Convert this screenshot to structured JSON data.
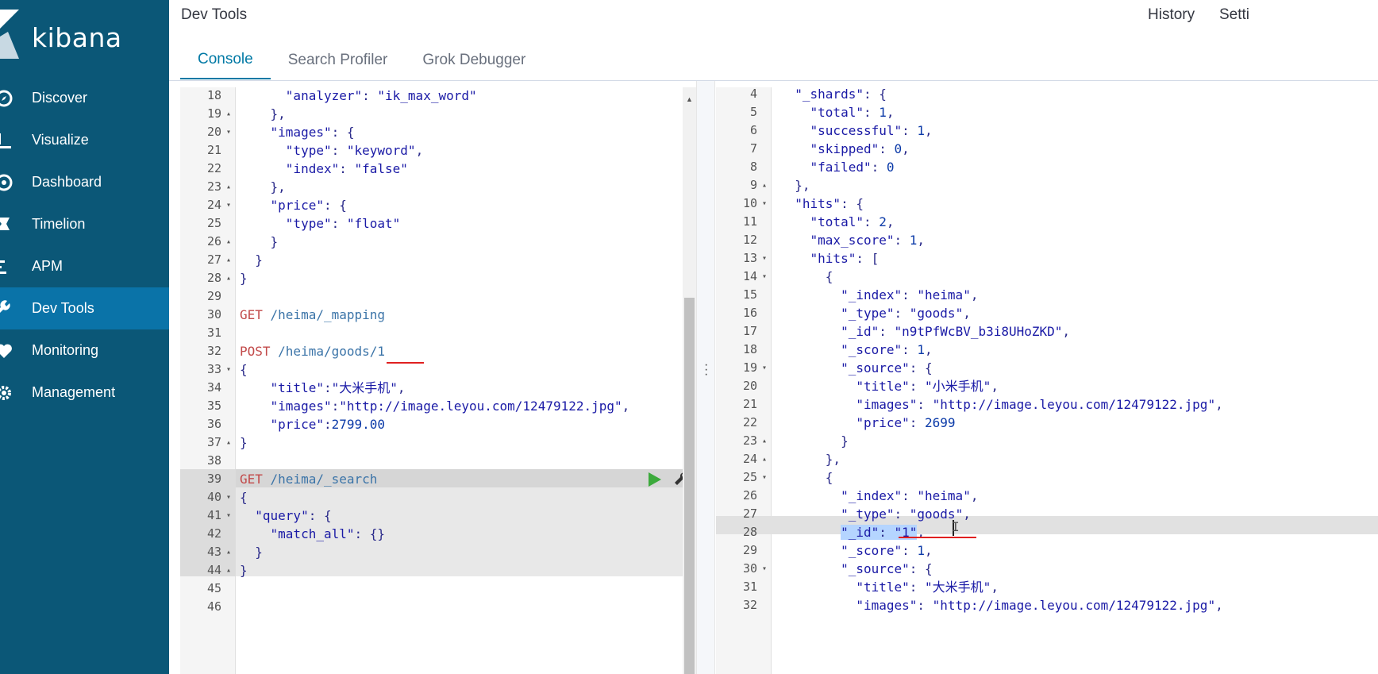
{
  "sidebar": {
    "logo_text": "kibana",
    "items": [
      {
        "label": "Discover",
        "icon": "compass-icon"
      },
      {
        "label": "Visualize",
        "icon": "bar-chart-icon"
      },
      {
        "label": "Dashboard",
        "icon": "dashboard-icon"
      },
      {
        "label": "Timelion",
        "icon": "timelion-icon"
      },
      {
        "label": "APM",
        "icon": "apm-icon"
      },
      {
        "label": "Dev Tools",
        "icon": "wrench-icon",
        "active": true
      },
      {
        "label": "Monitoring",
        "icon": "heartbeat-icon"
      },
      {
        "label": "Management",
        "icon": "gear-icon"
      }
    ],
    "colors": {
      "background": "#0b5777",
      "active": "#0a73a8"
    }
  },
  "header": {
    "title": "Dev Tools",
    "history_label": "History",
    "settings_label": "Setti"
  },
  "tabs": [
    {
      "label": "Console",
      "active": true
    },
    {
      "label": "Search Profiler"
    },
    {
      "label": "Grok Debugger"
    }
  ],
  "editor": {
    "lines": [
      {
        "n": "18",
        "fold": "",
        "html": "      <span class='s'>\"analyzer\"</span><span class='k'>: </span><span class='s'>\"ik_max_word\"</span>"
      },
      {
        "n": "19",
        "fold": "▴",
        "text": "    },"
      },
      {
        "n": "20",
        "fold": "▾",
        "text": "    \"images\": {"
      },
      {
        "n": "21",
        "fold": "",
        "text": "      \"type\": \"keyword\","
      },
      {
        "n": "22",
        "fold": "",
        "text": "      \"index\": \"false\""
      },
      {
        "n": "23",
        "fold": "▴",
        "text": "    },"
      },
      {
        "n": "24",
        "fold": "▾",
        "text": "    \"price\": {"
      },
      {
        "n": "25",
        "fold": "",
        "text": "      \"type\": \"float\""
      },
      {
        "n": "26",
        "fold": "▴",
        "text": "    }"
      },
      {
        "n": "27",
        "fold": "▴",
        "text": "  }"
      },
      {
        "n": "28",
        "fold": "▴",
        "text": "}"
      },
      {
        "n": "29",
        "fold": "",
        "text": ""
      },
      {
        "n": "30",
        "fold": "",
        "method": "GET",
        "url": " /heima/_mapping"
      },
      {
        "n": "31",
        "fold": "",
        "text": ""
      },
      {
        "n": "32",
        "fold": "",
        "method": "POST",
        "url": " /heima/goods/1"
      },
      {
        "n": "33",
        "fold": "▾",
        "text": "{"
      },
      {
        "n": "34",
        "fold": "",
        "text": "    \"title\":\"大米手机\","
      },
      {
        "n": "35",
        "fold": "",
        "text": "    \"images\":\"http://image.leyou.com/12479122.jpg\","
      },
      {
        "n": "36",
        "fold": "",
        "text": "    \"price\":2799.00"
      },
      {
        "n": "37",
        "fold": "▴",
        "text": "}"
      },
      {
        "n": "38",
        "fold": "",
        "text": ""
      },
      {
        "n": "39",
        "fold": "",
        "method": "GET",
        "url": " /heima/_search"
      },
      {
        "n": "40",
        "fold": "▾",
        "text": "{"
      },
      {
        "n": "41",
        "fold": "▾",
        "text": "  \"query\": {"
      },
      {
        "n": "42",
        "fold": "",
        "text": "    \"match_all\": {}"
      },
      {
        "n": "43",
        "fold": "▴",
        "text": "  }"
      },
      {
        "n": "44",
        "fold": "▴",
        "text": "}"
      },
      {
        "n": "45",
        "fold": "",
        "text": ""
      },
      {
        "n": "46",
        "fold": "",
        "text": ""
      }
    ]
  },
  "output": {
    "lines": [
      {
        "n": "4",
        "fold": "",
        "text": "  \"_shards\": {"
      },
      {
        "n": "5",
        "fold": "",
        "text": "    \"total\": 1,"
      },
      {
        "n": "6",
        "fold": "",
        "text": "    \"successful\": 1,"
      },
      {
        "n": "7",
        "fold": "",
        "text": "    \"skipped\": 0,"
      },
      {
        "n": "8",
        "fold": "",
        "text": "    \"failed\": 0"
      },
      {
        "n": "9",
        "fold": "▴",
        "text": "  },"
      },
      {
        "n": "10",
        "fold": "▾",
        "text": "  \"hits\": {"
      },
      {
        "n": "11",
        "fold": "",
        "text": "    \"total\": 2,"
      },
      {
        "n": "12",
        "fold": "",
        "text": "    \"max_score\": 1,"
      },
      {
        "n": "13",
        "fold": "▾",
        "text": "    \"hits\": ["
      },
      {
        "n": "14",
        "fold": "▾",
        "text": "      {"
      },
      {
        "n": "15",
        "fold": "",
        "text": "        \"_index\": \"heima\","
      },
      {
        "n": "16",
        "fold": "",
        "text": "        \"_type\": \"goods\","
      },
      {
        "n": "17",
        "fold": "",
        "text": "        \"_id\": \"n9tPfWcBV_b3i8UHoZKD\","
      },
      {
        "n": "18",
        "fold": "",
        "text": "        \"_score\": 1,"
      },
      {
        "n": "19",
        "fold": "▾",
        "text": "        \"_source\": {"
      },
      {
        "n": "20",
        "fold": "",
        "text": "          \"title\": \"小米手机\","
      },
      {
        "n": "21",
        "fold": "",
        "text": "          \"images\": \"http://image.leyou.com/12479122.jpg\","
      },
      {
        "n": "22",
        "fold": "",
        "text": "          \"price\": 2699"
      },
      {
        "n": "23",
        "fold": "▴",
        "text": "        }"
      },
      {
        "n": "24",
        "fold": "▴",
        "text": "      },"
      },
      {
        "n": "25",
        "fold": "▾",
        "text": "      {"
      },
      {
        "n": "26",
        "fold": "",
        "text": "        \"_index\": \"heima\","
      },
      {
        "n": "27",
        "fold": "",
        "text": "        \"_type\": \"goods\","
      },
      {
        "n": "28",
        "fold": "",
        "text": "        \"_id\": \"1\","
      },
      {
        "n": "29",
        "fold": "",
        "text": "        \"_score\": 1,"
      },
      {
        "n": "30",
        "fold": "▾",
        "text": "        \"_source\": {"
      },
      {
        "n": "31",
        "fold": "",
        "text": "          \"title\": \"大米手机\","
      },
      {
        "n": "32",
        "fold": "",
        "text": "          \"images\": \"http://image.leyou.com/12479122.jpg\","
      }
    ]
  }
}
